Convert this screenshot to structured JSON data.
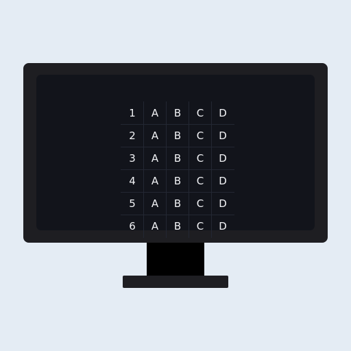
{
  "answer_sheet": {
    "rows": [
      {
        "number": "1",
        "options": [
          "A",
          "B",
          "C",
          "D"
        ]
      },
      {
        "number": "2",
        "options": [
          "A",
          "B",
          "C",
          "D"
        ]
      },
      {
        "number": "3",
        "options": [
          "A",
          "B",
          "C",
          "D"
        ]
      },
      {
        "number": "4",
        "options": [
          "A",
          "B",
          "C",
          "D"
        ]
      },
      {
        "number": "5",
        "options": [
          "A",
          "B",
          "C",
          "D"
        ]
      },
      {
        "number": "6",
        "options": [
          "A",
          "B",
          "C",
          "D"
        ]
      }
    ]
  },
  "colors": {
    "background": "#e4ecf4",
    "bezel": "#1e1e22",
    "screen": "#12141b",
    "stand_neck": "#000000",
    "text": "#f2f3f6",
    "grid_line": "#232733"
  }
}
